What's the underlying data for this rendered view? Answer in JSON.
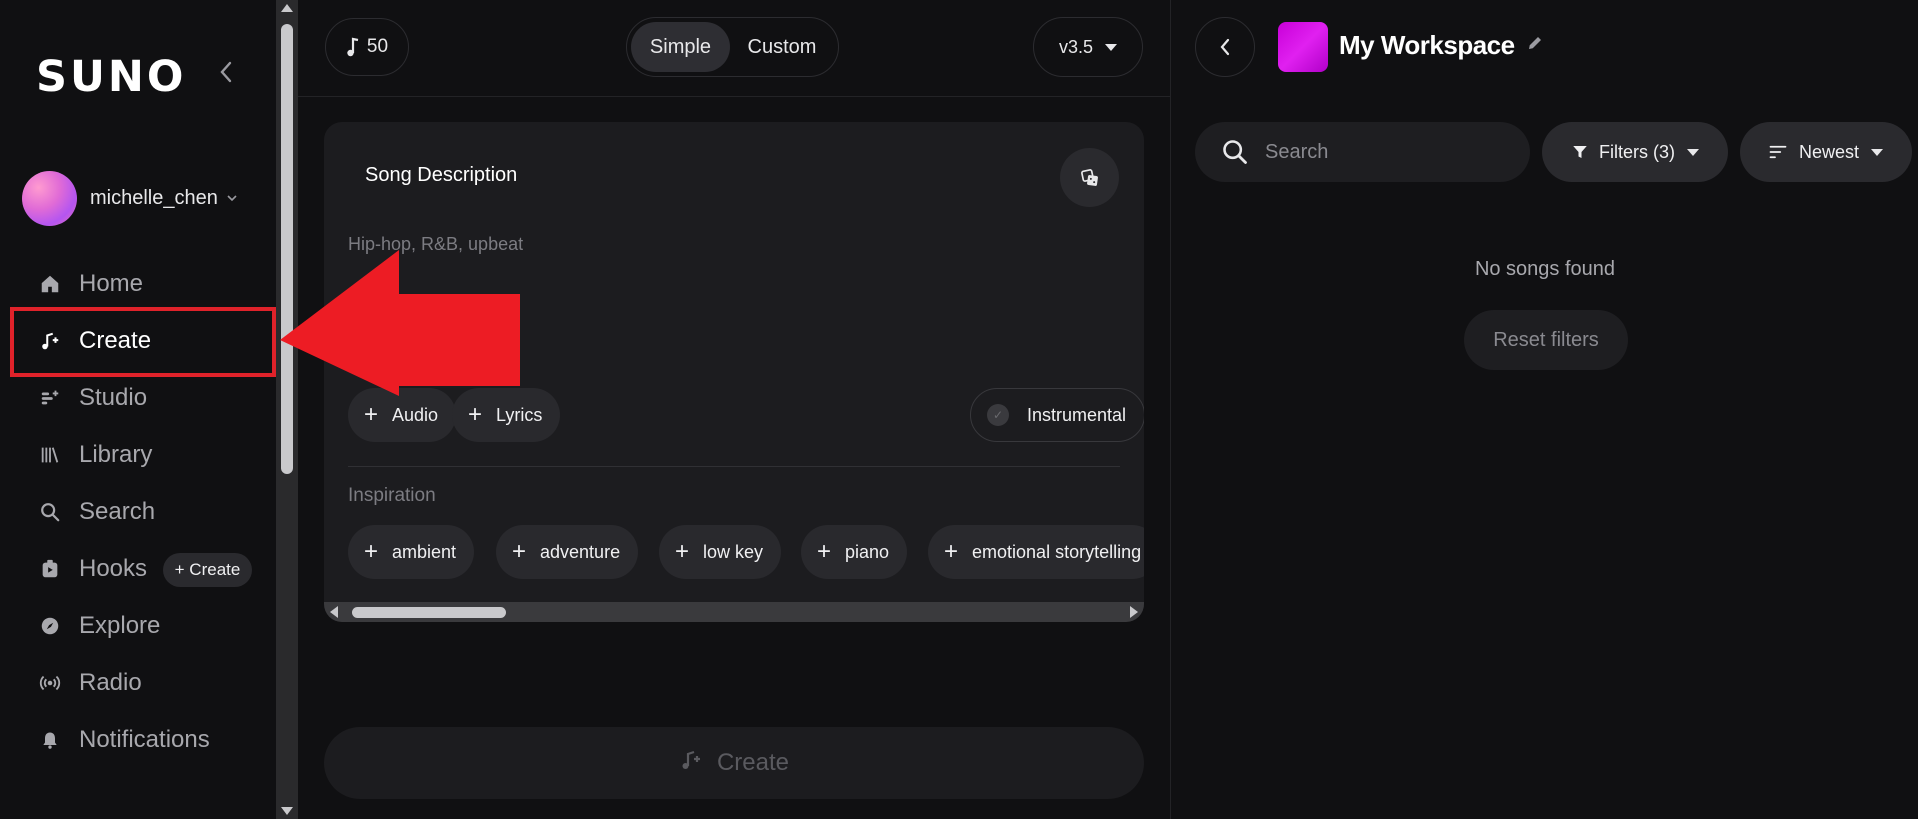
{
  "brand": {
    "logo": "SUNO"
  },
  "user": {
    "name": "michelle_chen"
  },
  "nav": [
    {
      "id": "home",
      "label": "Home",
      "icon": "home-icon"
    },
    {
      "id": "create",
      "label": "Create",
      "icon": "create-music-icon",
      "active": true
    },
    {
      "id": "studio",
      "label": "Studio",
      "icon": "studio-icon"
    },
    {
      "id": "library",
      "label": "Library",
      "icon": "library-icon"
    },
    {
      "id": "search",
      "label": "Search",
      "icon": "search-icon"
    },
    {
      "id": "hooks",
      "label": "Hooks",
      "icon": "hooks-icon"
    },
    {
      "id": "explore",
      "label": "Explore",
      "icon": "compass-icon"
    },
    {
      "id": "radio",
      "label": "Radio",
      "icon": "radio-icon"
    },
    {
      "id": "notifications",
      "label": "Notifications",
      "icon": "bell-icon"
    }
  ],
  "hooks_create_label": "+ Create",
  "toolbar": {
    "credits": "50",
    "mode_simple": "Simple",
    "mode_custom": "Custom",
    "version": "v3.5"
  },
  "song_card": {
    "title": "Song Description",
    "placeholder": "Hip-hop, R&B, upbeat",
    "audio_label": "Audio",
    "lyrics_label": "Lyrics",
    "instrumental_label": "Instrumental",
    "inspiration_label": "Inspiration",
    "inspiration_tags": [
      "ambient",
      "adventure",
      "low key",
      "piano",
      "emotional storytelling"
    ]
  },
  "create_button_label": "Create",
  "workspace": {
    "title": "My Workspace",
    "search_placeholder": "Search",
    "filters_label": "Filters (3)",
    "sort_label": "Newest",
    "empty_message": "No songs found",
    "reset_label": "Reset filters"
  },
  "colors": {
    "highlight": "#e0222a",
    "arrow": "#ed1c24",
    "workspace_thumb": "#d010e0"
  }
}
